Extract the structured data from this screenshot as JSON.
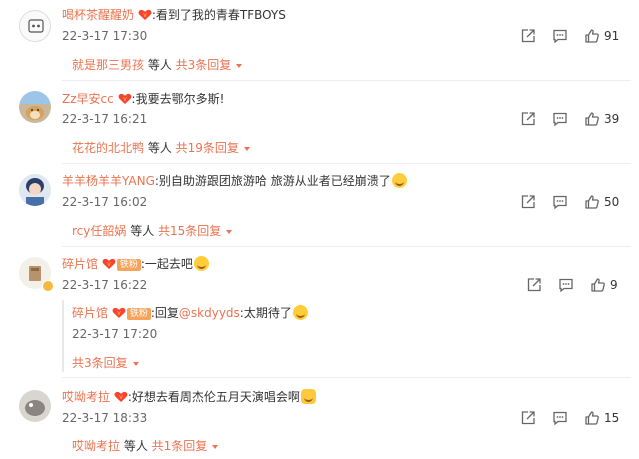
{
  "comments": [
    {
      "username": "喝杯茶醒醒奶",
      "text": ":看到了我的青春TFBOYS",
      "time": "22-3-17 17:30",
      "likes": "91",
      "reply_by": "就是那三男孩",
      "reply_mid": " 等人 ",
      "reply_count": "共3条回复"
    },
    {
      "username": "Zz早安cc",
      "text": ":我要去鄂尔多斯!",
      "time": "22-3-17 16:21",
      "likes": "39",
      "reply_by": "花花的北北鸭",
      "reply_mid": " 等人 ",
      "reply_count": "共19条回复"
    },
    {
      "username": "羊羊杨羊羊YANG",
      "text": ":别自助游跟团旅游哈  旅游从业者已经崩溃了",
      "time": "22-3-17 16:02",
      "likes": "50",
      "reply_by": "rcy任韶娲",
      "reply_mid": " 等人 ",
      "reply_count": "共15条回复"
    },
    {
      "username": "碎片馆",
      "badge": "铁粉",
      "text": ":一起去吧",
      "time": "22-3-17 16:22",
      "likes": "9",
      "sub_reply": {
        "username": "碎片馆",
        "badge": "铁粉",
        "text_prefix": ":回复",
        "mention": "@skdyyds",
        "text_suffix": ":太期待了",
        "time": "22-3-17 17:20"
      },
      "reply_count": "共3条回复"
    },
    {
      "username": "哎呦考拉",
      "text": ":好想去看周杰伦五月天演唱会啊",
      "time": "22-3-17 18:33",
      "likes": "15",
      "reply_by": "哎呦考拉",
      "reply_mid": " 等人 ",
      "reply_count": "共1条回复"
    }
  ],
  "icons": {
    "share": "share-icon",
    "comment": "comment-icon",
    "like": "like-icon",
    "vip": "heart-vip-icon"
  },
  "colors": {
    "accent": "#eb7350",
    "text": "#333333",
    "muted": "#666666"
  }
}
